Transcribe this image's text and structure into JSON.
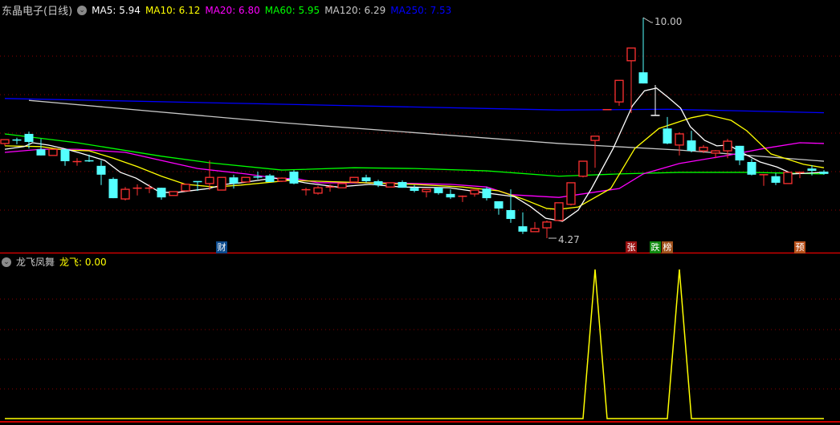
{
  "header": {
    "stock": "东晶电子(日线)",
    "ma": [
      {
        "label": "MA5: 5.94",
        "color": "#ffffff"
      },
      {
        "label": "MA10: 6.12",
        "color": "#ffff00"
      },
      {
        "label": "MA20: 6.80",
        "color": "#ff00ff"
      },
      {
        "label": "MA60: 5.95",
        "color": "#00ff00"
      },
      {
        "label": "MA120: 6.29",
        "color": "#c8c8c8"
      },
      {
        "label": "MA250: 7.53",
        "color": "#0000ff"
      }
    ]
  },
  "indicator": {
    "name": "龙飞凤舞",
    "value_label": "龙飞: 0.00",
    "color": "#ffff00",
    "values_nonzero": [
      [
        49,
        1
      ],
      [
        56,
        1
      ]
    ],
    "count": 69
  },
  "annotations": {
    "high_label": "10.00",
    "high_index": 53,
    "high_price": 10.0,
    "low_label": "4.27",
    "low_index": 45,
    "low_price": 4.27
  },
  "markers": [
    {
      "text": "财",
      "index": 18,
      "bg": "#0c4a8c"
    },
    {
      "text": "张",
      "index": 52,
      "bg": "#9a1010"
    },
    {
      "text": "跌",
      "index": 54,
      "bg": "#108a10"
    },
    {
      "text": "榜",
      "index": 55,
      "bg": "#a0501a"
    },
    {
      "text": "预",
      "index": 66,
      "bg": "#b8501a"
    }
  ],
  "colors": {
    "up": "#ff3232",
    "down": "#54ffff",
    "flat": "#ffffff",
    "grid": "#8b0000",
    "divider": "#cc0000"
  },
  "chart_data": {
    "type": "candlestick",
    "price_range": [
      4.2,
      10.0
    ],
    "grid_prices": [
      9,
      8,
      7,
      6,
      5
    ],
    "candles_ohlc": [
      [
        6.73,
        6.83,
        6.67,
        6.83
      ],
      [
        6.82,
        6.88,
        6.71,
        6.8
      ],
      [
        6.98,
        7.04,
        6.6,
        6.77
      ],
      [
        6.58,
        6.85,
        6.42,
        6.42
      ],
      [
        6.42,
        6.58,
        6.42,
        6.58
      ],
      [
        6.58,
        6.58,
        6.15,
        6.27
      ],
      [
        6.24,
        6.35,
        6.15,
        6.26
      ],
      [
        6.28,
        6.44,
        6.25,
        6.26
      ],
      [
        6.15,
        6.29,
        5.65,
        5.92
      ],
      [
        5.81,
        5.85,
        5.31,
        5.31
      ],
      [
        5.29,
        5.6,
        5.25,
        5.54
      ],
      [
        5.55,
        5.67,
        5.38,
        5.57
      ],
      [
        5.55,
        5.67,
        5.44,
        5.57
      ],
      [
        5.58,
        5.58,
        5.27,
        5.33
      ],
      [
        5.38,
        5.48,
        5.38,
        5.48
      ],
      [
        5.5,
        5.69,
        5.48,
        5.67
      ],
      [
        5.74,
        5.74,
        5.5,
        5.72
      ],
      [
        5.69,
        6.29,
        5.52,
        5.85
      ],
      [
        5.52,
        5.85,
        5.52,
        5.85
      ],
      [
        5.85,
        5.92,
        5.56,
        5.69
      ],
      [
        5.73,
        5.85,
        5.73,
        5.85
      ],
      [
        5.86,
        6.0,
        5.8,
        5.84
      ],
      [
        5.9,
        5.94,
        5.73,
        5.73
      ],
      [
        5.75,
        5.85,
        5.73,
        5.83
      ],
      [
        6.0,
        6.04,
        5.67,
        5.69
      ],
      [
        5.51,
        5.58,
        5.38,
        5.53
      ],
      [
        5.44,
        5.63,
        5.4,
        5.58
      ],
      [
        5.58,
        5.67,
        5.48,
        5.6
      ],
      [
        5.58,
        5.69,
        5.58,
        5.69
      ],
      [
        5.73,
        5.85,
        5.73,
        5.85
      ],
      [
        5.85,
        5.92,
        5.71,
        5.75
      ],
      [
        5.75,
        5.79,
        5.6,
        5.65
      ],
      [
        5.6,
        5.71,
        5.6,
        5.71
      ],
      [
        5.73,
        5.77,
        5.58,
        5.58
      ],
      [
        5.58,
        5.65,
        5.46,
        5.5
      ],
      [
        5.48,
        5.54,
        5.33,
        5.54
      ],
      [
        5.58,
        5.6,
        5.4,
        5.44
      ],
      [
        5.42,
        5.54,
        5.29,
        5.33
      ],
      [
        5.34,
        5.38,
        5.21,
        5.36
      ],
      [
        5.42,
        5.52,
        5.35,
        5.52
      ],
      [
        5.56,
        5.6,
        5.25,
        5.31
      ],
      [
        5.23,
        5.23,
        4.88,
        5.04
      ],
      [
        5.0,
        5.54,
        4.67,
        4.77
      ],
      [
        4.58,
        4.94,
        4.38,
        4.44
      ],
      [
        4.44,
        4.69,
        4.44,
        4.52
      ],
      [
        4.54,
        4.73,
        4.27,
        4.69
      ],
      [
        4.73,
        5.19,
        4.73,
        5.19
      ],
      [
        5.15,
        5.71,
        5.12,
        5.71
      ],
      [
        5.88,
        6.27,
        5.85,
        6.27
      ],
      [
        6.81,
        6.92,
        6.1,
        6.92
      ],
      [
        7.61,
        7.61,
        7.61,
        7.61
      ],
      [
        7.81,
        8.37,
        7.71,
        8.37
      ],
      [
        8.88,
        9.21,
        7.52,
        9.21
      ],
      [
        8.58,
        10.0,
        8.29,
        8.29
      ],
      [
        7.46,
        8.25,
        7.46,
        7.46
      ],
      [
        7.12,
        7.42,
        6.71,
        6.73
      ],
      [
        6.69,
        7.02,
        6.42,
        6.98
      ],
      [
        6.81,
        7.06,
        6.5,
        6.54
      ],
      [
        6.54,
        6.69,
        6.48,
        6.63
      ],
      [
        6.48,
        6.56,
        6.35,
        6.54
      ],
      [
        6.54,
        6.85,
        6.35,
        6.79
      ],
      [
        6.67,
        6.67,
        6.17,
        6.29
      ],
      [
        6.25,
        6.33,
        5.9,
        5.92
      ],
      [
        5.9,
        5.92,
        5.63,
        5.92
      ],
      [
        5.88,
        5.96,
        5.65,
        5.71
      ],
      [
        5.69,
        5.98,
        5.69,
        5.98
      ],
      [
        5.96,
        5.98,
        5.83,
        5.98
      ],
      [
        6.08,
        6.17,
        5.9,
        6.02
      ],
      [
        6.0,
        6.04,
        5.92,
        5.94
      ]
    ],
    "series": [
      {
        "name": "MA250",
        "color": "#0000ff",
        "points": [
          [
            0,
            7.9
          ],
          [
            46,
            7.6
          ],
          [
            55,
            7.62
          ],
          [
            68,
            7.53
          ]
        ]
      },
      {
        "name": "MA120",
        "color": "#c8c8c8",
        "points": [
          [
            2,
            7.85
          ],
          [
            23,
            7.27
          ],
          [
            46,
            6.73
          ],
          [
            56,
            6.56
          ],
          [
            68,
            6.27
          ]
        ]
      },
      {
        "name": "MA60",
        "color": "#00ff00",
        "points": [
          [
            0,
            6.98
          ],
          [
            6,
            6.75
          ],
          [
            13,
            6.4
          ],
          [
            17,
            6.23
          ],
          [
            23,
            6.04
          ],
          [
            29,
            6.1
          ],
          [
            34,
            6.08
          ],
          [
            40,
            6.02
          ],
          [
            46,
            5.88
          ],
          [
            51,
            5.94
          ],
          [
            56,
            5.98
          ],
          [
            62,
            5.98
          ],
          [
            68,
            5.94
          ]
        ]
      },
      {
        "name": "MA20",
        "color": "#ff00ff",
        "points": [
          [
            0,
            6.5
          ],
          [
            3,
            6.58
          ],
          [
            6,
            6.58
          ],
          [
            10,
            6.5
          ],
          [
            13,
            6.29
          ],
          [
            16,
            6.08
          ],
          [
            20,
            5.94
          ],
          [
            23,
            5.81
          ],
          [
            24,
            5.83
          ],
          [
            26,
            5.71
          ],
          [
            31,
            5.71
          ],
          [
            37,
            5.67
          ],
          [
            40,
            5.6
          ],
          [
            42,
            5.4
          ],
          [
            46,
            5.33
          ],
          [
            51,
            5.56
          ],
          [
            53,
            5.94
          ],
          [
            56,
            6.21
          ],
          [
            60,
            6.42
          ],
          [
            63,
            6.6
          ],
          [
            66,
            6.75
          ],
          [
            68,
            6.73
          ]
        ]
      },
      {
        "name": "MA10",
        "color": "#ffff00",
        "points": [
          [
            0,
            6.67
          ],
          [
            3,
            6.65
          ],
          [
            5,
            6.56
          ],
          [
            7,
            6.54
          ],
          [
            9,
            6.35
          ],
          [
            11,
            6.13
          ],
          [
            13,
            5.88
          ],
          [
            15,
            5.67
          ],
          [
            17.4,
            5.6
          ],
          [
            19.6,
            5.65
          ],
          [
            23.6,
            5.77
          ],
          [
            26,
            5.75
          ],
          [
            30,
            5.71
          ],
          [
            34,
            5.67
          ],
          [
            38,
            5.6
          ],
          [
            41,
            5.5
          ],
          [
            43,
            5.29
          ],
          [
            45,
            5.04
          ],
          [
            46,
            5.02
          ],
          [
            47.6,
            5.08
          ],
          [
            50.3,
            5.56
          ],
          [
            52.3,
            6.6
          ],
          [
            54.3,
            7.12
          ],
          [
            57,
            7.4
          ],
          [
            58.3,
            7.48
          ],
          [
            60.3,
            7.33
          ],
          [
            61.6,
            7.06
          ],
          [
            63.6,
            6.46
          ],
          [
            66.3,
            6.19
          ],
          [
            68,
            6.1
          ]
        ]
      },
      {
        "name": "MA5",
        "color": "#ffffff",
        "points": [
          [
            0,
            6.58
          ],
          [
            1.6,
            6.65
          ],
          [
            2.3,
            6.75
          ],
          [
            3.6,
            6.69
          ],
          [
            4.9,
            6.6
          ],
          [
            6.3,
            6.48
          ],
          [
            8.3,
            6.29
          ],
          [
            9.6,
            5.98
          ],
          [
            10.9,
            5.83
          ],
          [
            12.9,
            5.46
          ],
          [
            14.3,
            5.46
          ],
          [
            16.9,
            5.56
          ],
          [
            18.3,
            5.67
          ],
          [
            19.6,
            5.71
          ],
          [
            22.3,
            5.83
          ],
          [
            23.6,
            5.79
          ],
          [
            24.9,
            5.71
          ],
          [
            27.6,
            5.6
          ],
          [
            30.3,
            5.67
          ],
          [
            32.9,
            5.6
          ],
          [
            36.9,
            5.58
          ],
          [
            39.6,
            5.46
          ],
          [
            42.3,
            5.35
          ],
          [
            43.6,
            5.1
          ],
          [
            44.9,
            4.79
          ],
          [
            46.3,
            4.71
          ],
          [
            47.6,
            5.0
          ],
          [
            48.7,
            5.56
          ],
          [
            50.5,
            6.6
          ],
          [
            52.1,
            7.71
          ],
          [
            53.1,
            8.1
          ],
          [
            54.1,
            8.17
          ],
          [
            55.1,
            7.92
          ],
          [
            56.1,
            7.65
          ],
          [
            56.9,
            7.17
          ],
          [
            58.1,
            6.81
          ],
          [
            59.1,
            6.67
          ],
          [
            60.1,
            6.69
          ],
          [
            61.4,
            6.46
          ],
          [
            62.7,
            6.25
          ],
          [
            64.1,
            6.12
          ],
          [
            65.4,
            5.94
          ],
          [
            68,
            5.98
          ]
        ]
      }
    ]
  }
}
